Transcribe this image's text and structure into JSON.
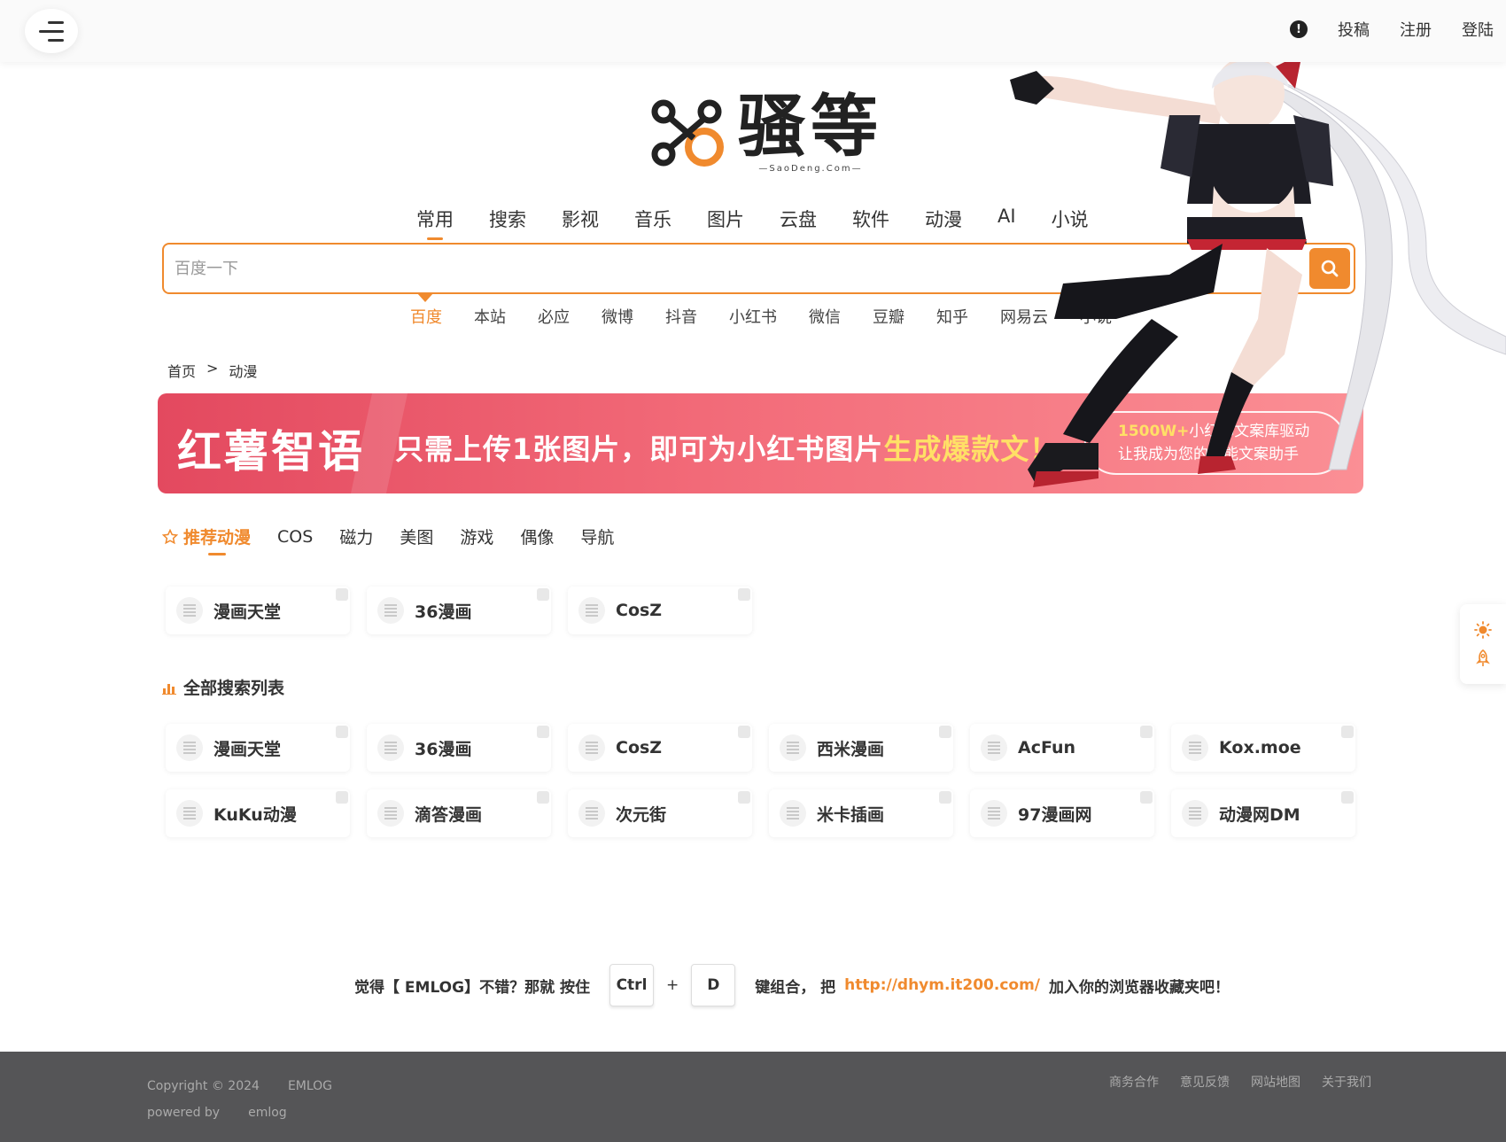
{
  "header": {
    "actions": [
      "投稿",
      "注册",
      "登陆"
    ]
  },
  "logo": {
    "name": "骚等",
    "sub": "—SaoDeng.Com—"
  },
  "category_tabs": [
    "常用",
    "搜索",
    "影视",
    "音乐",
    "图片",
    "云盘",
    "软件",
    "动漫",
    "AI",
    "小说"
  ],
  "search": {
    "placeholder": "百度一下"
  },
  "engines": [
    "百度",
    "本站",
    "必应",
    "微博",
    "抖音",
    "小红书",
    "微信",
    "豆瓣",
    "知乎",
    "网易云",
    "小说"
  ],
  "breadcrumb": {
    "home": "首页",
    "sep": ">",
    "current": "动漫"
  },
  "banner": {
    "title": "红薯智语",
    "slogan_a": "只需上传1张图片，即可为小红书图片",
    "slogan_b": "生成爆款文！",
    "pill_line1_hl": "1500W+",
    "pill_line1": "小红书文案库驱动",
    "pill_line2": "让我成为您的智能文案助手"
  },
  "sub_tabs": [
    "推荐动漫",
    "COS",
    "磁力",
    "美图",
    "游戏",
    "偶像",
    "导航"
  ],
  "recommended": [
    "漫画天堂",
    "36漫画",
    "CosZ"
  ],
  "all_list_title": "全部搜索列表",
  "all_list": [
    "漫画天堂",
    "36漫画",
    "CosZ",
    "西米漫画",
    "AcFun",
    "Kox.moe",
    "KuKu动漫",
    "滴答漫画",
    "次元街",
    "米卡插画",
    "97漫画网",
    "动漫网DM"
  ],
  "bookmark": {
    "prefix": "觉得【 EMLOG】不错？那就 按住",
    "key1": "Ctrl",
    "plus": "+",
    "key2": "D",
    "mid": "键组合，  把",
    "link": "http://dhym.it200.com/",
    "suffix": "加入你的浏览器收藏夹吧！"
  },
  "footer": {
    "copyright": "Copyright © 2024",
    "site": "EMLOG",
    "powered": "powered by",
    "engine": "emlog",
    "links": [
      "商务合作",
      "意见反馈",
      "网站地图",
      "关于我们"
    ]
  },
  "colors": {
    "accent": "#f08a2e",
    "banner": "#ee5a6f",
    "footer": "#555557"
  }
}
